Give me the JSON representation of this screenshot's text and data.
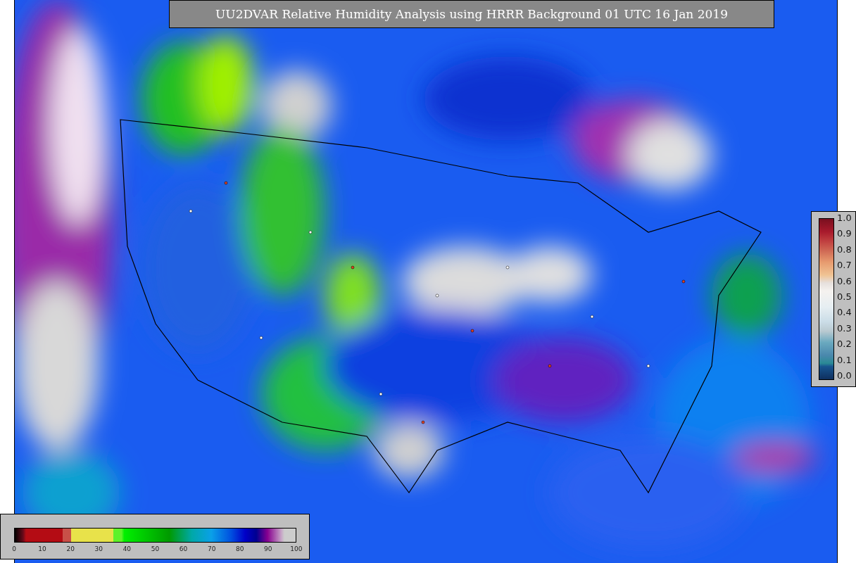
{
  "title": "UU2DVAR Relative Humidity Analysis using HRRR Background 01 UTC 16 Jan 2019",
  "station_colorbar": {
    "ticks": [
      "1.0",
      "0.9",
      "0.8",
      "0.7",
      "0.6",
      "0.5",
      "0.4",
      "0.3",
      "0.2",
      "0.1",
      "0.0"
    ]
  },
  "humidity_colorbar": {
    "ticks": [
      "0",
      "10",
      "20",
      "30",
      "40",
      "50",
      "60",
      "70",
      "80",
      "90",
      "100"
    ]
  }
}
